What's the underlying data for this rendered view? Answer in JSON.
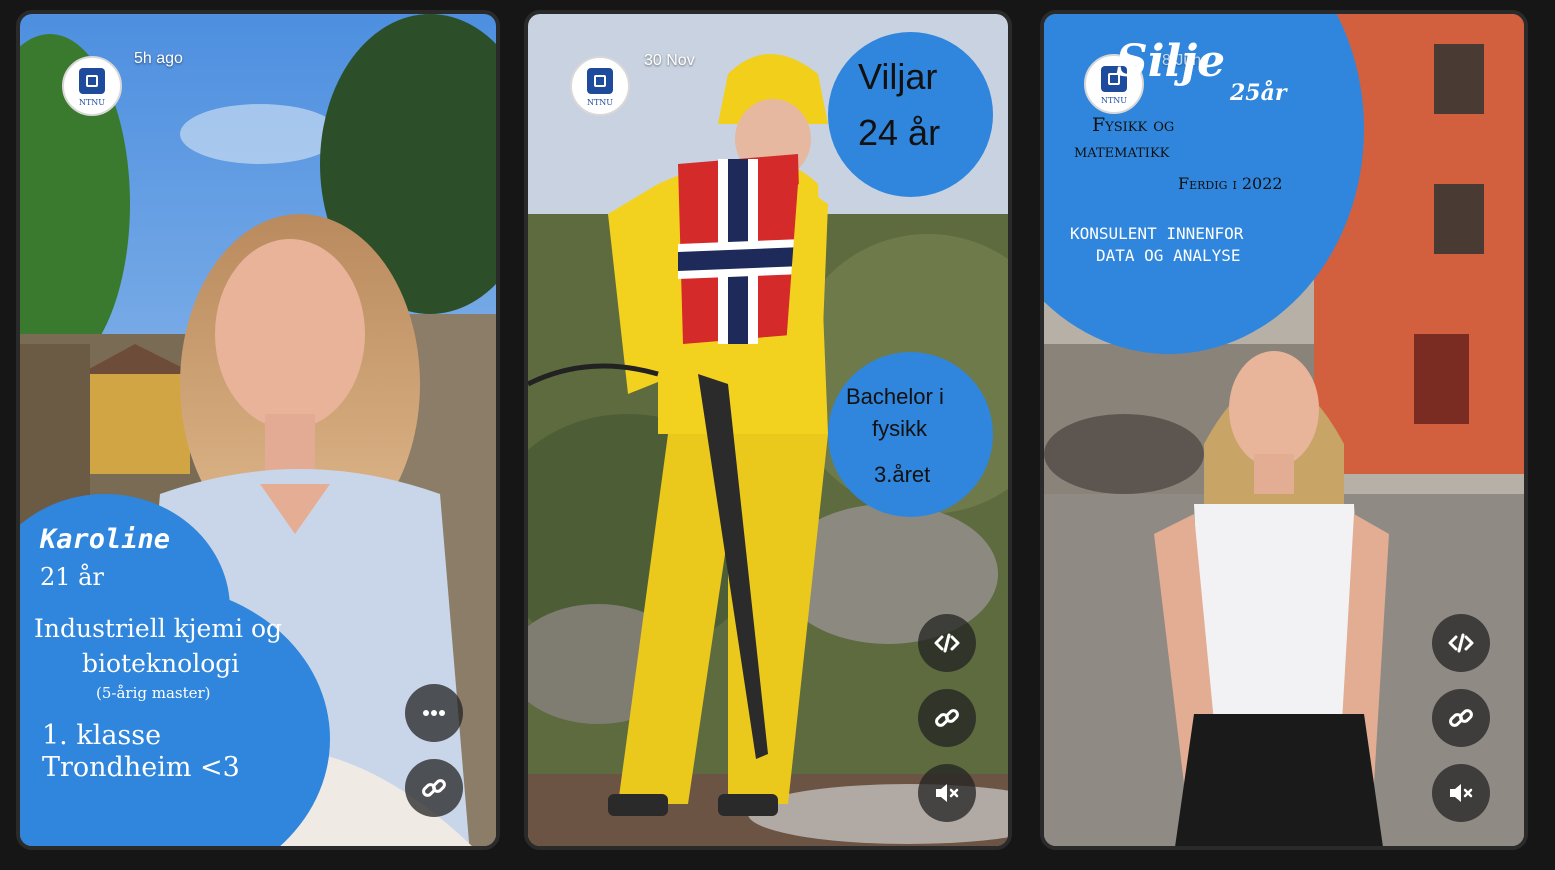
{
  "cards": [
    {
      "avatar_text": "NTNU",
      "timestamp": "5h ago",
      "name": "Karoline",
      "age": "21 år",
      "study_line1": "Industriell kjemi og",
      "study_line2": "bioteknologi",
      "study_note": "(5-årig master)",
      "year": "1. klasse",
      "city": "Trondheim <3"
    },
    {
      "avatar_text": "NTNU",
      "timestamp": "30 Nov",
      "name": "Viljar",
      "age": "24 år",
      "study_line1": "Bachelor i",
      "study_line2": "fysikk",
      "year": "3.året"
    },
    {
      "avatar_text": "NTNU",
      "timestamp": "8 Jun",
      "name": "Silje",
      "age": "25år",
      "study_line1": "Fysikk og",
      "study_line2": "matematikk",
      "done": "Ferdig i 2022",
      "job_line1": "KONSULENT INNENFOR",
      "job_line2": "DATA OG ANALYSE"
    }
  ],
  "colors": {
    "bubble": "#2f86dc",
    "button_bg": "#232323"
  },
  "icons": [
    "ntnu-logo-icon",
    "more-icon",
    "link-icon",
    "embed-code-icon",
    "mute-icon"
  ]
}
